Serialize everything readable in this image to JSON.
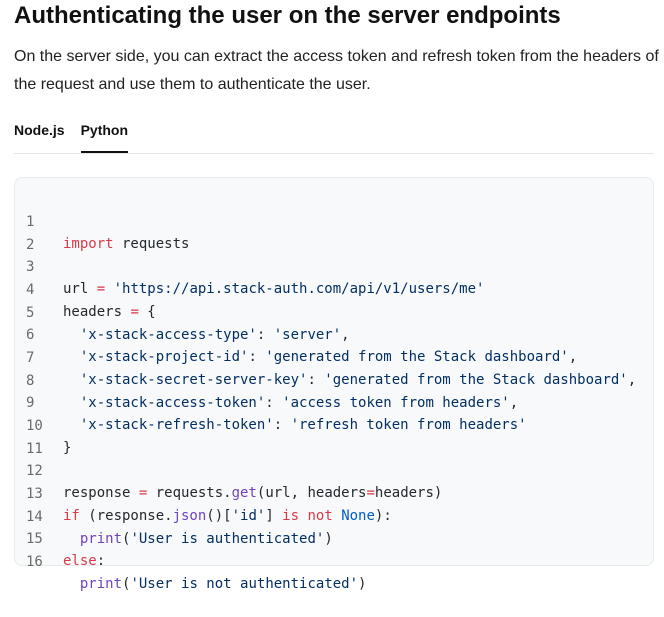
{
  "header": {
    "title": "Authenticating the user on the server endpoints",
    "lead": "On the server side, you can extract the access token and refresh token from the headers of the request and use them to authenticate the user."
  },
  "tabs": [
    {
      "label": "Node.js",
      "active": false
    },
    {
      "label": "Python",
      "active": true
    }
  ],
  "code": {
    "language": "python",
    "line_numbers": [
      "1",
      "2",
      "3",
      "4",
      "5",
      "6",
      "7",
      "8",
      "9",
      "10",
      "11",
      "12",
      "13",
      "14",
      "15",
      "16"
    ],
    "tokens": {
      "l1_kw": "import",
      "l1_rest": " requests",
      "l3_a": "url ",
      "l3_op": "=",
      "l3_str": " 'https://api.stack-auth.com/api/v1/users/me'",
      "l4_a": "headers ",
      "l4_op": "=",
      "l4_b": " {",
      "l5_k": "  'x-stack-access-type'",
      "l5_m": ": ",
      "l5_v": "'server'",
      "l5_e": ",",
      "l6_k": "  'x-stack-project-id'",
      "l6_m": ": ",
      "l6_v": "'generated from the Stack dashboard'",
      "l6_e": ",",
      "l7_k": "  'x-stack-secret-server-key'",
      "l7_m": ": ",
      "l7_v": "'generated from the Stack dashboard'",
      "l7_e": ",",
      "l8_k": "  'x-stack-access-token'",
      "l8_m": ": ",
      "l8_v": "'access token from headers'",
      "l8_e": ",",
      "l9_k": "  'x-stack-refresh-token'",
      "l9_m": ": ",
      "l9_v": "'refresh token from headers'",
      "l10": "}",
      "l12_a": "response ",
      "l12_op": "=",
      "l12_b": " requests.",
      "l12_fn": "get",
      "l12_c": "(url, headers",
      "l12_op2": "=",
      "l12_d": "headers)",
      "l13_kw": "if",
      "l13_a": " (response.",
      "l13_fn": "json",
      "l13_b": "()[",
      "l13_str": "'id'",
      "l13_c": "] ",
      "l13_kw2": "is not",
      "l13_sp": " ",
      "l13_bi": "None",
      "l13_d": "):",
      "l14_sp": "  ",
      "l14_fn": "print",
      "l14_a": "(",
      "l14_str": "'User is authenticated'",
      "l14_b": ")",
      "l15_kw": "else",
      "l15_a": ":",
      "l16_sp": "  ",
      "l16_fn": "print",
      "l16_a": "(",
      "l16_str": "'User is not authenticated'",
      "l16_b": ")"
    }
  },
  "colors": {
    "keyword": "#d73a49",
    "string": "#032f62",
    "function": "#6f42c1",
    "builtin": "#005cc5",
    "code_bg": "#f8f9fa"
  }
}
